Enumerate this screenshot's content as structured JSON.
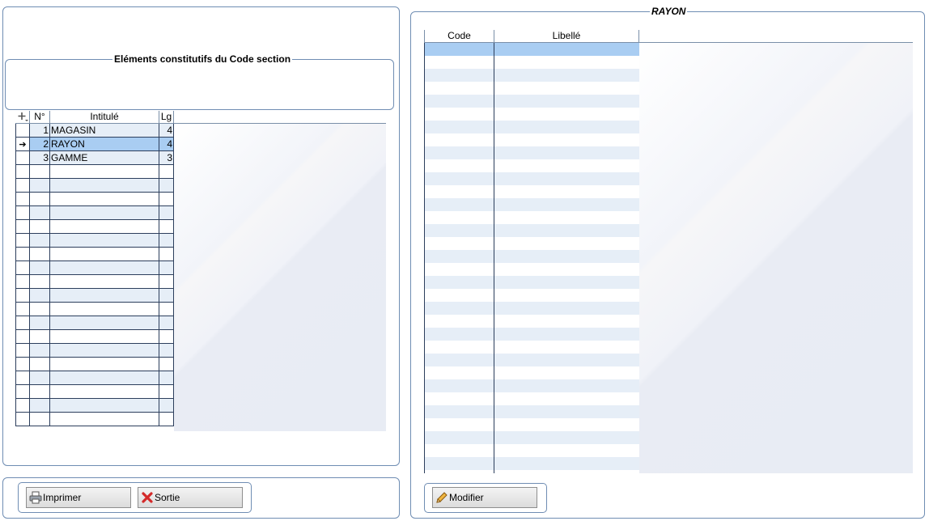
{
  "left_panel": {
    "group_title": "Eléments constitutifs du Code section",
    "grid": {
      "add_icon": "add-row-icon",
      "columns": [
        "N°",
        "Intitulé",
        "Lg"
      ],
      "rows": [
        {
          "n": "1",
          "label": "MAGASIN",
          "lg": "4"
        },
        {
          "n": "2",
          "label": "RAYON",
          "lg": "4",
          "selected": true
        },
        {
          "n": "3",
          "label": "GAMME",
          "lg": "3"
        }
      ]
    }
  },
  "right_panel": {
    "group_title": "RAYON",
    "grid": {
      "columns": [
        "Code",
        "Libellé"
      ]
    }
  },
  "buttons": {
    "print": {
      "label": "Imprimer",
      "icon": "printer-icon"
    },
    "exit": {
      "label": "Sortie",
      "icon": "red-x-icon"
    },
    "edit": {
      "label": "Modifier",
      "icon": "pencil-icon"
    }
  },
  "colors": {
    "border": "#6f8db3",
    "selected_row": "#a9cdf2",
    "alt_row": "#e6eef7"
  }
}
